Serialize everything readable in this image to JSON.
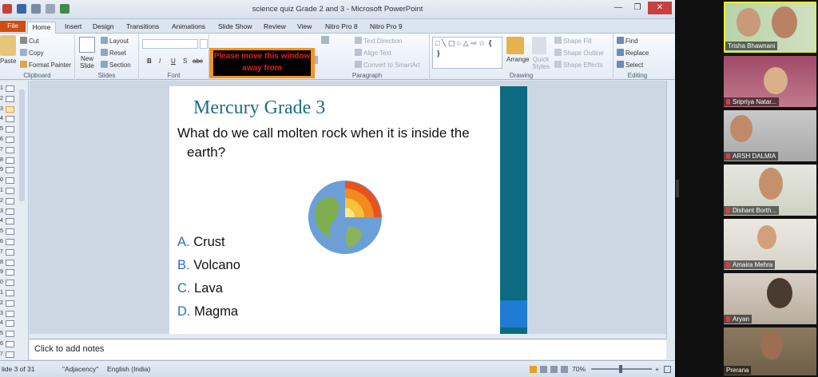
{
  "window": {
    "title": "science quiz Grade 2 and 3 - Microsoft PowerPoint"
  },
  "tabs": [
    {
      "label": "File"
    },
    {
      "label": "Home"
    },
    {
      "label": "Insert"
    },
    {
      "label": "Design"
    },
    {
      "label": "Transitions"
    },
    {
      "label": "Animations"
    },
    {
      "label": "Slide Show"
    },
    {
      "label": "Review"
    },
    {
      "label": "View"
    },
    {
      "label": "Nitro Pro 8"
    },
    {
      "label": "Nitro Pro 9"
    }
  ],
  "ribbon": {
    "clipboard": {
      "label": "Clipboard",
      "paste": "Paste",
      "cut": "Cut",
      "copy": "Copy",
      "format_painter": "Format Painter"
    },
    "slides": {
      "label": "Slides",
      "new_slide": "New Slide",
      "layout": "Layout",
      "reset": "Reset",
      "section": "Section"
    },
    "font": {
      "label": "Font",
      "bold": "B",
      "italic": "I",
      "underline": "U",
      "shadow": "S",
      "strike": "abc"
    },
    "paragraph": {
      "label": "Paragraph",
      "text_direction": "Text Direction",
      "align_text": "Align Text",
      "convert_smartart": "Convert to SmartArt"
    },
    "drawing": {
      "label": "Drawing",
      "arrange": "Arrange",
      "quick_styles": "Quick Styles",
      "shape_fill": "Shape Fill",
      "shape_outline": "Shape Outline",
      "shape_effects": "Shape Effects"
    },
    "editing": {
      "label": "Editing",
      "find": "Find",
      "replace": "Replace",
      "select": "Select"
    }
  },
  "overlay_warning": {
    "text": "Please move this window away from"
  },
  "thumbnails": [
    {
      "num": "1"
    },
    {
      "num": "2"
    },
    {
      "num": "3",
      "selected": true
    },
    {
      "num": "4"
    },
    {
      "num": "5"
    },
    {
      "num": "6"
    },
    {
      "num": "7"
    },
    {
      "num": "8"
    },
    {
      "num": "9"
    },
    {
      "num": "0"
    },
    {
      "num": "1"
    },
    {
      "num": "2"
    },
    {
      "num": "3"
    },
    {
      "num": "4"
    },
    {
      "num": "5"
    },
    {
      "num": "6"
    },
    {
      "num": "7"
    },
    {
      "num": "8"
    },
    {
      "num": "9"
    },
    {
      "num": "0"
    },
    {
      "num": "1"
    },
    {
      "num": "2"
    },
    {
      "num": "3"
    },
    {
      "num": "4"
    },
    {
      "num": "5"
    },
    {
      "num": "6"
    },
    {
      "num": "7"
    }
  ],
  "slide": {
    "title": "Mercury Grade 3",
    "question_line1": "What do we call molten rock when it is inside the",
    "question_line2": "earth?",
    "options": [
      {
        "letter": "A.",
        "text": "Crust"
      },
      {
        "letter": "B.",
        "text": "Volcano"
      },
      {
        "letter": "C.",
        "text": "Lava"
      },
      {
        "letter": "D.",
        "text": "Magma"
      }
    ]
  },
  "notes": {
    "placeholder": "Click to add notes"
  },
  "status": {
    "slide": "lide 3 of 31",
    "theme": "\"Adjacency\"",
    "language": "English (India)",
    "zoom": "70%"
  },
  "colors": {
    "accent_teal": "#0c6b80",
    "accent_blue": "#1f7bd4",
    "title_color": "#1d6f83",
    "option_letter": "#2a6ebd",
    "active_speaker": "#e8ef2a"
  },
  "participants": [
    {
      "name": "Trisha Bhawnani",
      "active": true,
      "muted": false
    },
    {
      "name": "Sripriya Natar...",
      "muted": true
    },
    {
      "name": "ARSH DALMIA",
      "muted": true
    },
    {
      "name": "Dishant Borth...",
      "muted": true
    },
    {
      "name": "Amaira Mehra",
      "muted": true
    },
    {
      "name": "Aryan",
      "muted": true
    },
    {
      "name": "Prerana",
      "muted": false
    }
  ]
}
